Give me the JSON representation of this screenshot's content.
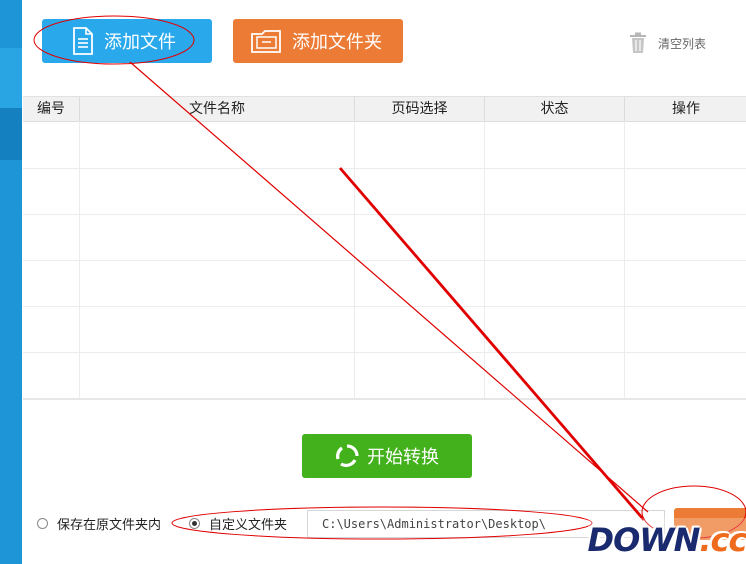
{
  "toolbar": {
    "add_file_label": "添加文件",
    "add_folder_label": "添加文件夹",
    "clear_list_label": "清空列表"
  },
  "table": {
    "columns": [
      "编号",
      "文件名称",
      "页码选择",
      "状态",
      "操作"
    ],
    "rows": []
  },
  "actions": {
    "start_label": "开始转换"
  },
  "output": {
    "option_original": "保存在原文件夹内",
    "option_custom": "自定义文件夹",
    "selected": "custom",
    "path_value": "C:\\Users\\Administrator\\Desktop\\"
  },
  "watermark": {
    "text": "DOWN",
    "suffix": ".cc"
  },
  "colors": {
    "add_file_button": "#29a9ec",
    "add_folder_button": "#ec7b35",
    "start_button": "#43b11b",
    "sidebar": "#1e95d6",
    "annotation": "#e00000"
  },
  "icons": {
    "add_file": "document-icon",
    "add_folder": "folder-icon",
    "clear_list": "trash-icon",
    "start": "refresh-icon"
  }
}
